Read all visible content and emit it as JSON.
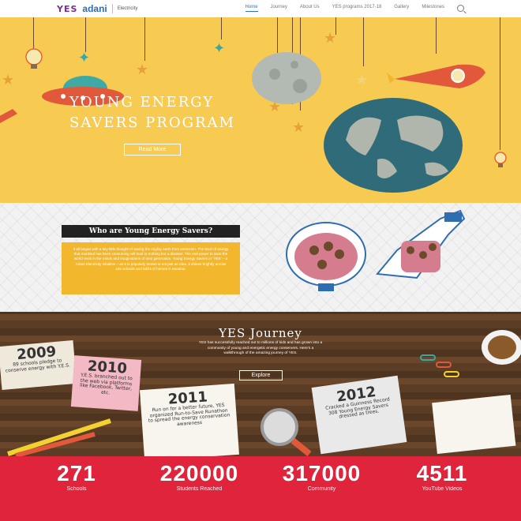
{
  "header": {
    "logo_yes": "YES",
    "logo_brand": "adani",
    "logo_sub": "Electricity",
    "nav": [
      "Home",
      "Journey",
      "About Us",
      "YES programs 2017-18",
      "Gallery",
      "Milestones"
    ]
  },
  "hero": {
    "title": "YOUNG ENERGY SAVERS PROGRAM",
    "button": "Read More"
  },
  "who": {
    "heading": "Who are Young Energy Savers?",
    "body": "It all began with a tiny little thought of saving the mighty earth from extinction. The level of energy that mankind has been consuming will lead to nothing but a disaster. The real power to save the world rests in the minds and imaginations of next generation. Young Energy Savers or 'YES' – a Adani Electricity initiative – as it is popularly known is not just an idea, it shines brightly across 235 schools and lakhs of homes in Mumbai."
  },
  "journey": {
    "title": "YES Journey",
    "text": "YES has successfully reached out to millions of kids and has grown into a community of young and energetic energy conservers. Here's a walkthrough of the amazing journey of YES.",
    "button": "Explore",
    "notes": [
      {
        "year": "2009",
        "text": "89 schools pledge to conserve energy with Y.E.S."
      },
      {
        "year": "2010",
        "text": "Y.E.S. branched out to the web via platforms like Facebook, Twitter, etc."
      },
      {
        "year": "2011",
        "text": "Run on for a better future, YES organized Run-to-Save Runathon to spread the energy conservation awareness"
      },
      {
        "year": "2012",
        "text": "Cracked a Guinness Record 308 Young Energy Savers dressed as trees."
      }
    ]
  },
  "stats": [
    {
      "value": "271",
      "label": "Schools"
    },
    {
      "value": "220000",
      "label": "Students Reached"
    },
    {
      "value": "317000",
      "label": "Community"
    },
    {
      "value": "4511",
      "label": "YouTube Videos"
    }
  ],
  "colors": {
    "hero_bg": "#f7ca52",
    "stats_bg": "#e0243b",
    "who_box": "#f2b72d",
    "nav_active": "#2d73c4"
  }
}
